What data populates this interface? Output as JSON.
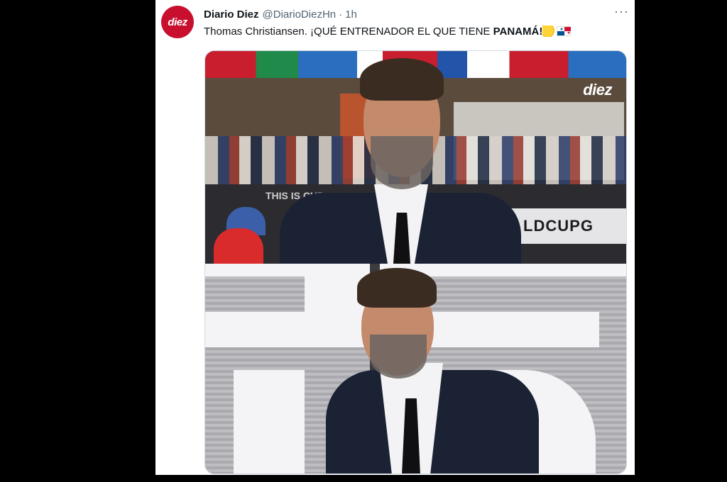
{
  "post": {
    "avatar_text": "diez",
    "display_name": "Diario Diez",
    "handle": "@DiarioDiezHn",
    "separator": "·",
    "time": "1h",
    "more": "···",
    "text_plain": "Thomas Christiansen. ¡QUÉ ENTRENADOR EL QUE TIENE ",
    "text_bold": "PANAMÁ",
    "text_end": "!",
    "emojis": [
      "clapping-hands-icon",
      "panama-flag-icon"
    ]
  },
  "media": {
    "watermark": "diez",
    "board_text_large": "LDCUPG",
    "board_text_small": "THIS IS CUP"
  },
  "colors": {
    "brand_red": "#c8102e",
    "text_primary": "#0f1419",
    "text_secondary": "#536471"
  }
}
